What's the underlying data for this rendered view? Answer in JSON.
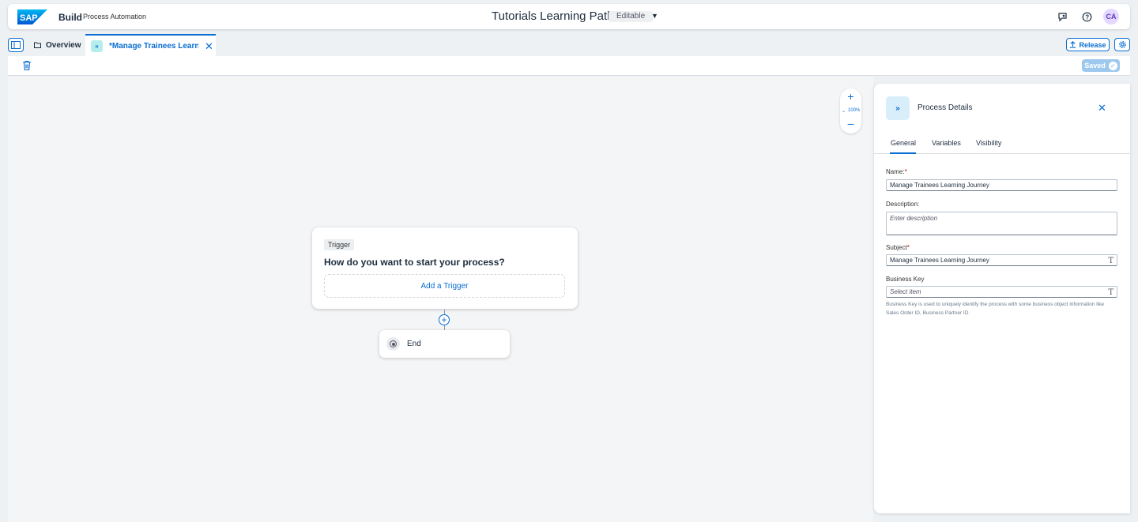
{
  "shell": {
    "product": "Build",
    "product_sub": "Process Automation",
    "title": "Tutorials Learning Path",
    "status": "Editable",
    "avatar_initials": "CA",
    "icons": [
      "feedback-icon",
      "help-icon"
    ]
  },
  "tabs": {
    "overview_label": "Overview",
    "active_label": "*Manage Trainees Learni...",
    "release_label": "Release"
  },
  "toolbar": {
    "saved_label": "Saved"
  },
  "canvas": {
    "zoom_level": "100%",
    "trigger_tag": "Trigger",
    "trigger_question": "How do you want to start your process?",
    "add_trigger_label": "Add a Trigger",
    "end_label": "End"
  },
  "panel": {
    "title": "Process Details",
    "tabs": [
      "General",
      "Variables",
      "Visibility"
    ],
    "name_label": "Name:",
    "name_value": "Manage Trainees Learning Journey",
    "description_label": "Description:",
    "description_placeholder": "Enter description",
    "subject_label": "Subject",
    "subject_value": "Manage Trainees Learning Journey",
    "business_key_label": "Business Key",
    "business_key_placeholder": "Select item",
    "business_key_help": "Business Key is used to uniquely identify the process with some business object information like Sales Order ID, Business Partner ID."
  },
  "colors": {
    "accent": "#0a6ed1",
    "saved": "#9ec9ee",
    "required": "#bb0000"
  }
}
